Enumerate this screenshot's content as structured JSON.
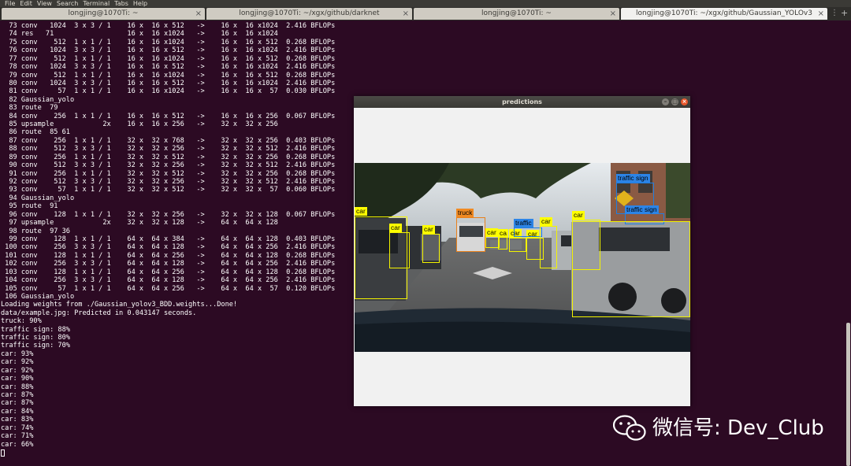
{
  "menu": [
    "File",
    "Edit",
    "View",
    "Search",
    "Terminal",
    "Tabs",
    "Help"
  ],
  "tabs": [
    {
      "title": "longjing@1070Ti: ~",
      "active": false
    },
    {
      "title": "longjing@1070Ti: ~/xgx/github/darknet",
      "active": false
    },
    {
      "title": "longjing@1070Ti: ~",
      "active": false
    },
    {
      "title": "longjing@1070Ti: ~/xgx/github/Gaussian_YOLOv3",
      "active": true
    }
  ],
  "terminal_lines": [
    "  73 conv   1024  3 x 3 / 1    16 x  16 x 512   ->    16 x  16 x1024  2.416 BFLOPs",
    "  74 res   71                  16 x  16 x1024   ->    16 x  16 x1024",
    "  75 conv    512  1 x 1 / 1    16 x  16 x1024   ->    16 x  16 x 512  0.268 BFLOPs",
    "  76 conv   1024  3 x 3 / 1    16 x  16 x 512   ->    16 x  16 x1024  2.416 BFLOPs",
    "  77 conv    512  1 x 1 / 1    16 x  16 x1024   ->    16 x  16 x 512  0.268 BFLOPs",
    "  78 conv   1024  3 x 3 / 1    16 x  16 x 512   ->    16 x  16 x1024  2.416 BFLOPs",
    "  79 conv    512  1 x 1 / 1    16 x  16 x1024   ->    16 x  16 x 512  0.268 BFLOPs",
    "  80 conv   1024  3 x 3 / 1    16 x  16 x 512   ->    16 x  16 x1024  2.416 BFLOPs",
    "  81 conv     57  1 x 1 / 1    16 x  16 x1024   ->    16 x  16 x  57  0.030 BFLOPs",
    "  82 Gaussian_yolo",
    "  83 route  79",
    "  84 conv    256  1 x 1 / 1    16 x  16 x 512   ->    16 x  16 x 256  0.067 BFLOPs",
    "  85 upsample            2x    16 x  16 x 256   ->    32 x  32 x 256",
    "  86 route  85 61",
    "  87 conv    256  1 x 1 / 1    32 x  32 x 768   ->    32 x  32 x 256  0.403 BFLOPs",
    "  88 conv    512  3 x 3 / 1    32 x  32 x 256   ->    32 x  32 x 512  2.416 BFLOPs",
    "  89 conv    256  1 x 1 / 1    32 x  32 x 512   ->    32 x  32 x 256  0.268 BFLOPs",
    "  90 conv    512  3 x 3 / 1    32 x  32 x 256   ->    32 x  32 x 512  2.416 BFLOPs",
    "  91 conv    256  1 x 1 / 1    32 x  32 x 512   ->    32 x  32 x 256  0.268 BFLOPs",
    "  92 conv    512  3 x 3 / 1    32 x  32 x 256   ->    32 x  32 x 512  2.416 BFLOPs",
    "  93 conv     57  1 x 1 / 1    32 x  32 x 512   ->    32 x  32 x  57  0.060 BFLOPs",
    "  94 Gaussian_yolo",
    "  95 route  91",
    "  96 conv    128  1 x 1 / 1    32 x  32 x 256   ->    32 x  32 x 128  0.067 BFLOPs",
    "  97 upsample            2x    32 x  32 x 128   ->    64 x  64 x 128",
    "  98 route  97 36",
    "  99 conv    128  1 x 1 / 1    64 x  64 x 384   ->    64 x  64 x 128  0.403 BFLOPs",
    " 100 conv    256  3 x 3 / 1    64 x  64 x 128   ->    64 x  64 x 256  2.416 BFLOPs",
    " 101 conv    128  1 x 1 / 1    64 x  64 x 256   ->    64 x  64 x 128  0.268 BFLOPs",
    " 102 conv    256  3 x 3 / 1    64 x  64 x 128   ->    64 x  64 x 256  2.416 BFLOPs",
    " 103 conv    128  1 x 1 / 1    64 x  64 x 256   ->    64 x  64 x 128  0.268 BFLOPs",
    " 104 conv    256  3 x 3 / 1    64 x  64 x 128   ->    64 x  64 x 256  2.416 BFLOPs",
    " 105 conv     57  1 x 1 / 1    64 x  64 x 256   ->    64 x  64 x  57  0.120 BFLOPs",
    " 106 Gaussian_yolo",
    "Loading weights from ./Gaussian_yolov3_BDD.weights...Done!",
    "data/example.jpg: Predicted in 0.043147 seconds.",
    "truck: 90%",
    "traffic sign: 88%",
    "traffic sign: 80%",
    "traffic sign: 70%",
    "car: 93%",
    "car: 92%",
    "car: 92%",
    "car: 90%",
    "car: 88%",
    "car: 87%",
    "car: 87%",
    "car: 84%",
    "car: 83%",
    "car: 74%",
    "car: 71%",
    "car: 66%"
  ],
  "predictions_window": {
    "title": "predictions",
    "buttons": {
      "minimize": "–",
      "maximize": "□",
      "close": "×"
    }
  },
  "detections": [
    {
      "label": "car",
      "color": "yellow"
    },
    {
      "label": "car",
      "color": "yellow"
    },
    {
      "label": "car",
      "color": "yellow"
    },
    {
      "label": "truck",
      "color": "orange"
    },
    {
      "label": "car",
      "color": "yellow"
    },
    {
      "label": "ca",
      "color": "yellow"
    },
    {
      "label": "car",
      "color": "yellow"
    },
    {
      "label": "car",
      "color": "yellow"
    },
    {
      "label": "traffic",
      "color": "blue"
    },
    {
      "label": "car",
      "color": "yellow"
    },
    {
      "label": "car",
      "color": "yellow"
    },
    {
      "label": "traffic sign",
      "color": "blue"
    },
    {
      "label": "traffic sign",
      "color": "blue"
    },
    {
      "label": "car",
      "color": "yellow"
    }
  ],
  "watermark": {
    "text": "微信号: Dev_Club",
    "icon": "wechat-icon"
  },
  "colors": {
    "terminal_bg": "#2c0a23",
    "box_yellow": "#ffff00",
    "box_blue": "#2c84e6",
    "box_orange": "#f08a23"
  }
}
